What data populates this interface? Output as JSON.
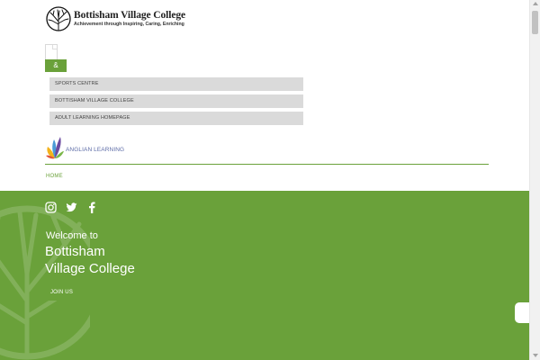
{
  "header": {
    "school_name": "Bottisham Village College",
    "tagline": "Achievement through Inspiring, Caring, Enriching",
    "logo_icon": "tree-logo-icon"
  },
  "menu": {
    "toggle_icon": "menu-toggle-icon",
    "search_symbol": "&"
  },
  "quick_links": [
    {
      "label": "SPORTS CENTRE"
    },
    {
      "label": "BOTTISHAM VILLAGE COLLEGE"
    },
    {
      "label": "ADULT LEARNING HOMEPAGE"
    }
  ],
  "partner": {
    "name": "ANGLIAN LEARNING",
    "icon": "anglian-learning-leaf-icon"
  },
  "breadcrumb": {
    "home": "HOME"
  },
  "hero": {
    "welcome": "Welcome to",
    "school_name": "Bottisham Village College",
    "join_label": "JOIN US",
    "social": [
      "instagram-icon",
      "twitter-icon",
      "facebook-icon"
    ]
  },
  "colors": {
    "brand_green": "#6aa13a",
    "link_grey": "#dadada",
    "partner_blue": "#5b6aa6"
  }
}
